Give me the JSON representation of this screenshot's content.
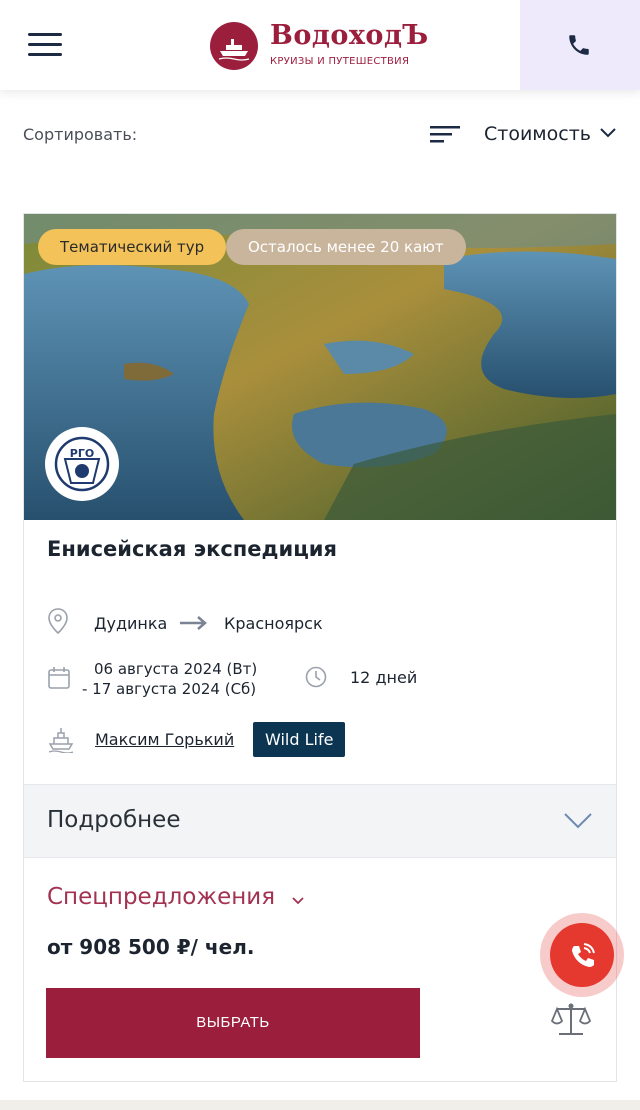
{
  "header": {
    "brand_name": "ВодоходЪ",
    "brand_subtitle": "КРУИЗЫ И ПУТЕШЕСТВИЯ",
    "brand_color": "#9b1f3d"
  },
  "sort": {
    "label": "Сортировать:",
    "value": "Стоимость"
  },
  "card": {
    "badges": {
      "theme": "Тематический тур",
      "cabins_left": "Осталось менее 20 кают"
    },
    "partner_logo_text": "РГО",
    "title": "Енисейская экспедиция",
    "route": {
      "from": "Дудинка",
      "to": "Красноярск"
    },
    "dates": {
      "start": "06 августа 2024 (Вт)",
      "end": "- 17 августа 2024 (Сб)"
    },
    "duration": "12 дней",
    "ship": "Максим Горький",
    "tag": "Wild Life",
    "details_label": "Подробнее",
    "special_offers_label": "Спецпредложения",
    "price": "от 908 500 ₽/ чел.",
    "select_button": "ВЫБРАТЬ"
  },
  "icons": {
    "menu": "hamburger-menu-icon",
    "phone": "phone-icon",
    "sort": "sort-lines-icon",
    "location": "location-pin-icon",
    "calendar": "calendar-icon",
    "clock": "clock-icon",
    "ship": "ship-icon",
    "compare": "scales-compare-icon",
    "call": "call-icon"
  },
  "colors": {
    "accent": "#9b1f3d",
    "special_text": "#a23250",
    "tag_bg": "#0c3552",
    "badge_theme": "#f3c35a",
    "badge_cabins": "#c9b59c",
    "call_button": "#e5382e"
  }
}
